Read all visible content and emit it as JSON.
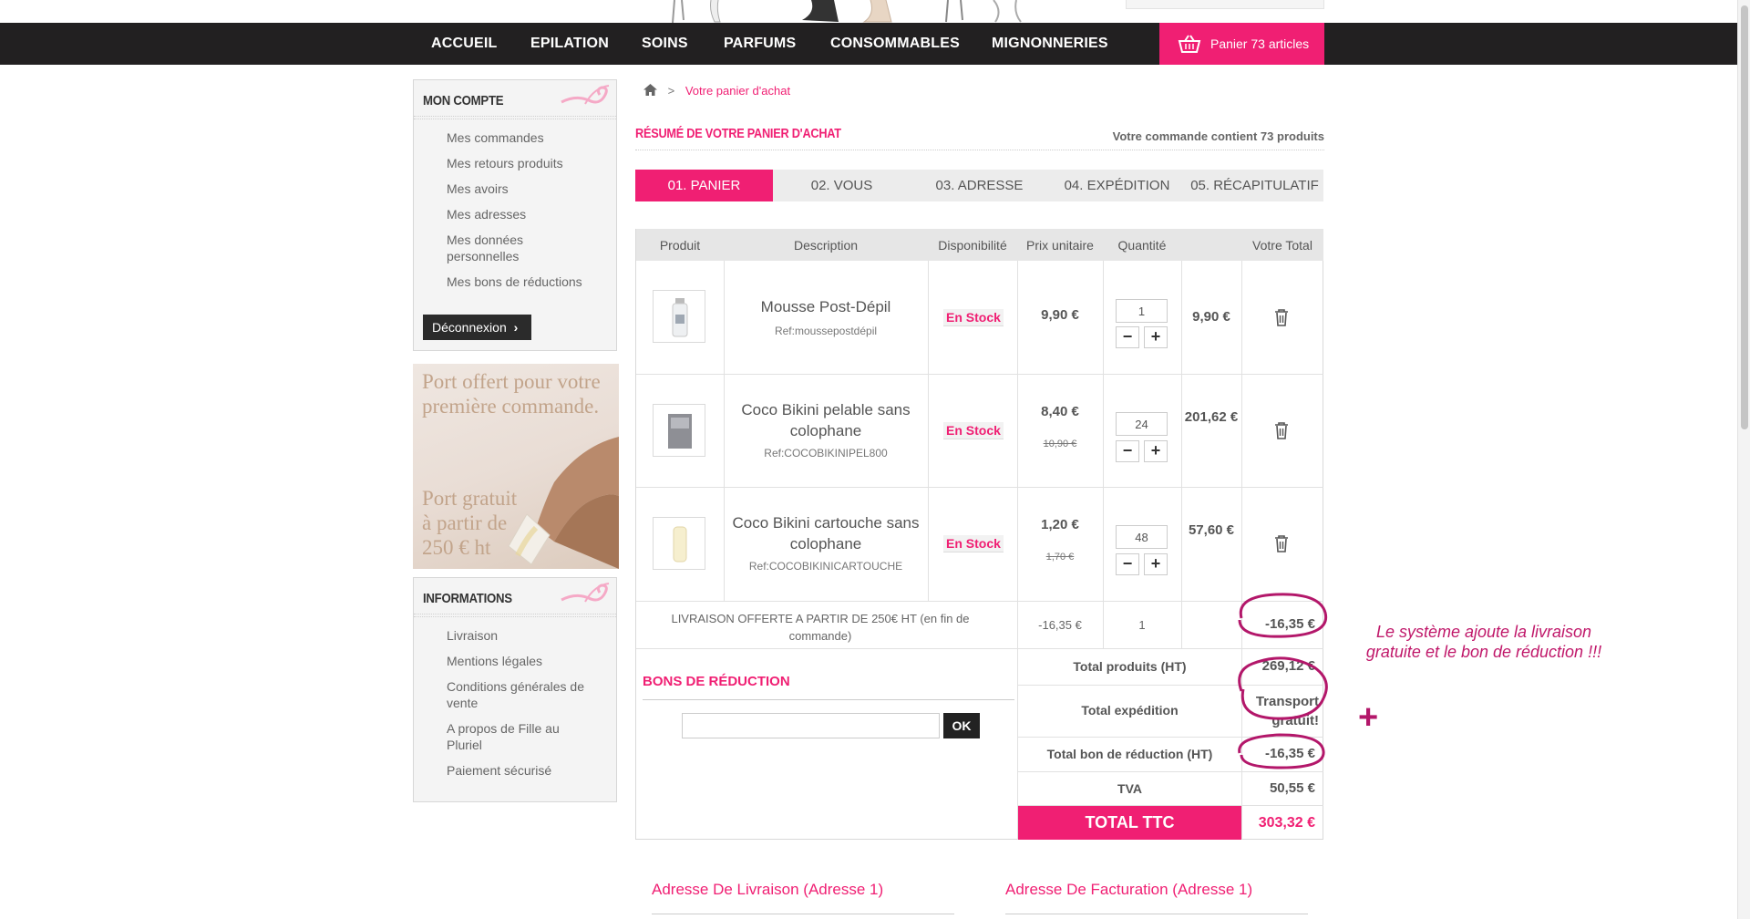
{
  "nav": {
    "items": [
      "ACCUEIL",
      "EPILATION",
      "SOINS",
      "PARFUMS",
      "CONSOMMABLES",
      "MIGNONNERIES"
    ],
    "cart_label": "Panier 73 articles"
  },
  "sidebar": {
    "account_title": "MON COMPTE",
    "account_links": [
      "Mes commandes",
      "Mes retours produits",
      "Mes avoirs",
      "Mes adresses",
      "Mes données personnelles",
      "Mes bons de réductions"
    ],
    "logout_label": "Déconnexion",
    "promo_line1": "Port offert pour votre première commande.",
    "promo_line2": "Port gratuit à partir de 250 € ht",
    "info_title": "INFORMATIONS",
    "info_links": [
      "Livraison",
      "Mentions légales",
      "Conditions générales de vente",
      "A propos de Fille au Pluriel",
      "Paiement sécurisé"
    ]
  },
  "breadcrumb": {
    "separator": ">",
    "current": "Votre panier d'achat"
  },
  "summary": {
    "title": "RÉSUMÉ DE VOTRE PANIER D'ACHAT",
    "count_text": "Votre commande contient 73 produits"
  },
  "steps": [
    "01. PANIER",
    "02. VOUS",
    "03. ADRESSE",
    "04. EXPÉDITION",
    "05. RÉCAPITULATIF"
  ],
  "table": {
    "headers": [
      "Produit",
      "Description",
      "Disponibilité",
      "Prix unitaire",
      "Quantité",
      "Votre Total"
    ],
    "rows": [
      {
        "name": "Mousse Post-Dépil",
        "ref": "Ref:moussepostdépil",
        "stock": "En Stock",
        "price": "9,90 €",
        "old_price": "",
        "qty": "1",
        "total": "9,90 €"
      },
      {
        "name": "Coco Bikini pelable sans colophane",
        "ref": "Ref:COCOBIKINIPEL800",
        "stock": "En Stock",
        "price": "8,40 €",
        "old_price": "10,90 €",
        "qty": "24",
        "total": "201,62 €"
      },
      {
        "name": "Coco Bikini cartouche sans colophane",
        "ref": "Ref:COCOBIKINICARTOUCHE",
        "stock": "En Stock",
        "price": "1,20 €",
        "old_price": "1,70 €",
        "qty": "48",
        "total": "57,60 €"
      }
    ],
    "shipping_row": {
      "desc": "LIVRAISON OFFERTE A PARTIR DE 250€ HT (en fin de commande)",
      "price": "-16,35 €",
      "qty": "1",
      "total": "-16,35 €"
    }
  },
  "discount": {
    "title": "BONS DE RÉDUCTION",
    "ok_label": "OK",
    "code_value": ""
  },
  "totals": {
    "products_label": "Total produits (HT)",
    "products_value": "269,12 €",
    "shipping_label": "Total expédition",
    "shipping_value": "Transport gratuit!",
    "discount_label": "Total bon de réduction (HT)",
    "discount_value": "-16,35 €",
    "tva_label": "TVA",
    "tva_value": "50,55 €",
    "ttc_label": "TOTAL TTC",
    "ttc_value": "303,32 €"
  },
  "addresses": {
    "delivery": "Adresse De Livraison (Adresse 1)",
    "billing": "Adresse De Facturation (Adresse 1)"
  },
  "annotation": {
    "text": "Le système ajoute la livraison gratuite et le bon de réduction !!!",
    "plus": "+"
  },
  "colors": {
    "accent": "#f01f73",
    "nav_bg": "#222021",
    "annotation": "#c0186a"
  },
  "icons": [
    "home-icon",
    "basket-icon",
    "trash-icon",
    "chevron-right-icon",
    "swirl-ornament-icon"
  ]
}
